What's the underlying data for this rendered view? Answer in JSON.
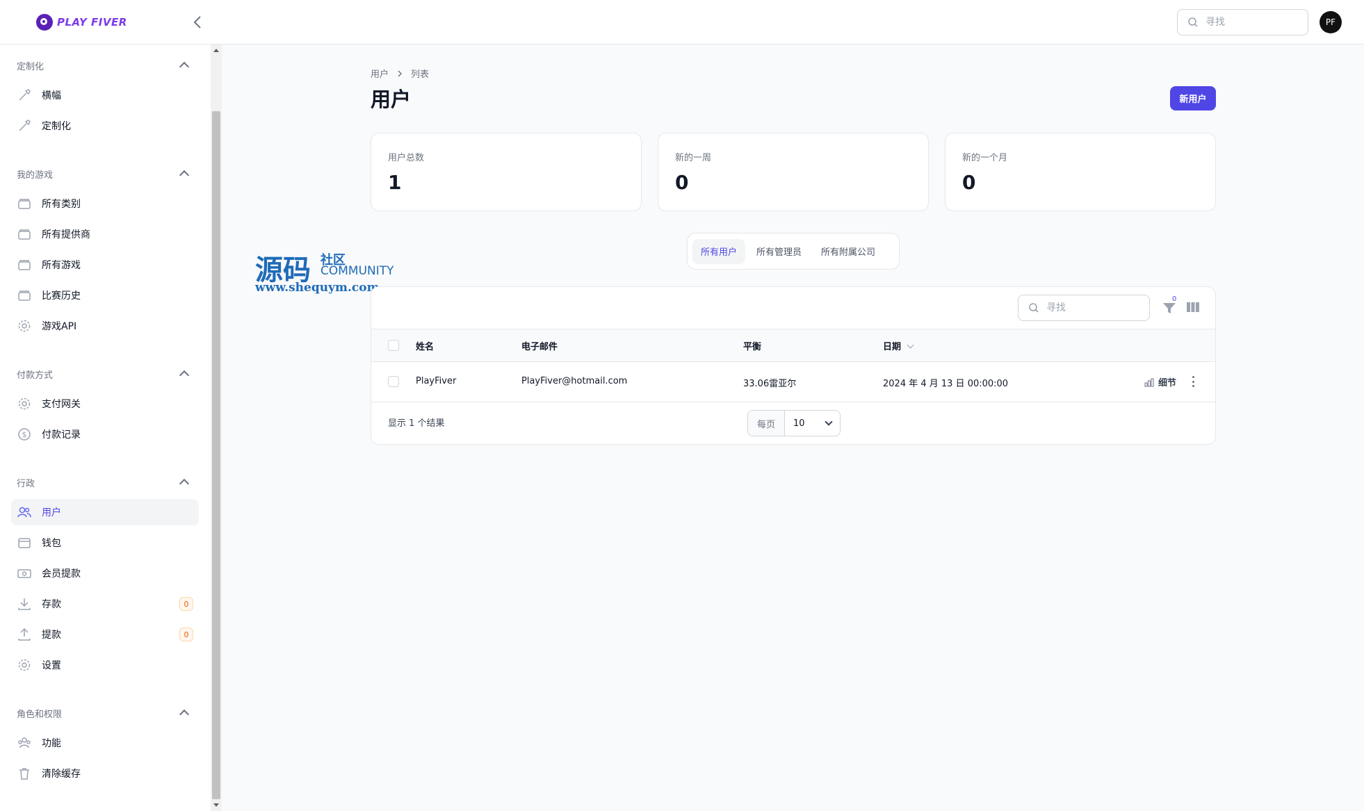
{
  "header": {
    "logo_text": "PLAY FIVER",
    "search_placeholder": "寻找",
    "avatar_initials": "PF"
  },
  "sidebar": {
    "groups": [
      {
        "label": "定制化",
        "items": [
          {
            "label": "横幅",
            "icon": "brush-icon"
          },
          {
            "label": "定制化",
            "icon": "brush-icon"
          }
        ]
      },
      {
        "label": "我的游戏",
        "items": [
          {
            "label": "所有类别",
            "icon": "folder-icon"
          },
          {
            "label": "所有提供商",
            "icon": "folder-icon"
          },
          {
            "label": "所有游戏",
            "icon": "folder-icon"
          },
          {
            "label": "比赛历史",
            "icon": "folder-icon"
          },
          {
            "label": "游戏API",
            "icon": "gear-icon"
          }
        ]
      },
      {
        "label": "付款方式",
        "items": [
          {
            "label": "支付网关",
            "icon": "gear-icon"
          },
          {
            "label": "付款记录",
            "icon": "dollar-icon"
          }
        ]
      },
      {
        "label": "行政",
        "items": [
          {
            "label": "用户",
            "icon": "users-icon",
            "active": true
          },
          {
            "label": "钱包",
            "icon": "wallet-icon"
          },
          {
            "label": "会员提款",
            "icon": "cash-icon"
          },
          {
            "label": "存款",
            "icon": "download-icon",
            "badge": "0"
          },
          {
            "label": "提款",
            "icon": "upload-icon",
            "badge": "0"
          },
          {
            "label": "设置",
            "icon": "gear-icon"
          }
        ]
      },
      {
        "label": "角色和权限",
        "items": [
          {
            "label": "功能",
            "icon": "user-group-icon"
          },
          {
            "label": "清除缓存",
            "icon": "trash-icon"
          }
        ]
      }
    ]
  },
  "breadcrumb": [
    "用户",
    "列表"
  ],
  "page_title": "用户",
  "new_user_label": "新用户",
  "stats": [
    {
      "label": "用户总数",
      "value": "1"
    },
    {
      "label": "新的一周",
      "value": "0"
    },
    {
      "label": "新的一个月",
      "value": "0"
    }
  ],
  "watermark": {
    "cn": "源码",
    "sub": "社区",
    "en": "COMMUNITY",
    "url": "www.shequym.com"
  },
  "tabs": [
    {
      "label": "所有用户",
      "active": true
    },
    {
      "label": "所有管理员"
    },
    {
      "label": "所有附属公司"
    }
  ],
  "table": {
    "search_placeholder": "寻找",
    "filter_count": "0",
    "columns": [
      "姓名",
      "电子邮件",
      "平衡",
      "日期"
    ],
    "rows": [
      {
        "name": "PlayFiver",
        "email": "PlayFiver@hotmail.com",
        "balance": "33.06雷亚尔",
        "date": "2024 年 4 月 13 日 00:00:00",
        "action": "细节"
      }
    ],
    "footer_text": "显示 1 个结果",
    "per_page_label": "每页",
    "per_page_value": "10"
  },
  "colors": {
    "accent": "#4f46e5",
    "badge": "#ea580c"
  }
}
